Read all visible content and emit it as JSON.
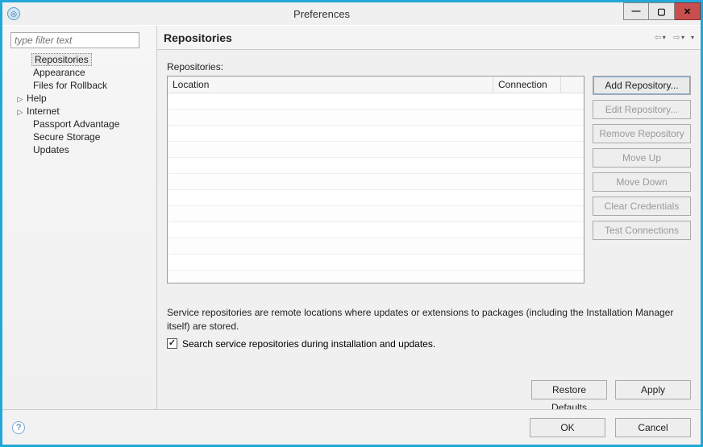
{
  "window": {
    "title": "Preferences"
  },
  "filter": {
    "placeholder": "type filter text"
  },
  "tree": {
    "items": [
      {
        "label": "Repositories",
        "selected": true,
        "indent": true,
        "expandable": false
      },
      {
        "label": "Appearance",
        "selected": false,
        "indent": true,
        "expandable": false
      },
      {
        "label": "Files for Rollback",
        "selected": false,
        "indent": true,
        "expandable": false
      },
      {
        "label": "Help",
        "selected": false,
        "indent": false,
        "expandable": true
      },
      {
        "label": "Internet",
        "selected": false,
        "indent": false,
        "expandable": true
      },
      {
        "label": "Passport Advantage",
        "selected": false,
        "indent": true,
        "expandable": false
      },
      {
        "label": "Secure Storage",
        "selected": false,
        "indent": true,
        "expandable": false
      },
      {
        "label": "Updates",
        "selected": false,
        "indent": true,
        "expandable": false
      }
    ]
  },
  "page": {
    "heading": "Repositories",
    "list_label": "Repositories:",
    "columns": {
      "location": "Location",
      "connection": "Connection"
    },
    "rows": [],
    "buttons": {
      "add": {
        "label": "Add Repository...",
        "enabled": true
      },
      "edit": {
        "label": "Edit Repository...",
        "enabled": false
      },
      "remove": {
        "label": "Remove Repository",
        "enabled": false
      },
      "up": {
        "label": "Move Up",
        "enabled": false
      },
      "down": {
        "label": "Move Down",
        "enabled": false
      },
      "clear": {
        "label": "Clear Credentials",
        "enabled": false
      },
      "test": {
        "label": "Test Connections",
        "enabled": false
      }
    },
    "description": "Service repositories are remote locations where updates or extensions to packages (including the Installation Manager itself) are stored.",
    "checkbox": {
      "label": "Search service repositories during installation and updates.",
      "checked": true
    },
    "restore_defaults": "Restore Defaults",
    "apply": "Apply"
  },
  "footer": {
    "ok": "OK",
    "cancel": "Cancel"
  }
}
